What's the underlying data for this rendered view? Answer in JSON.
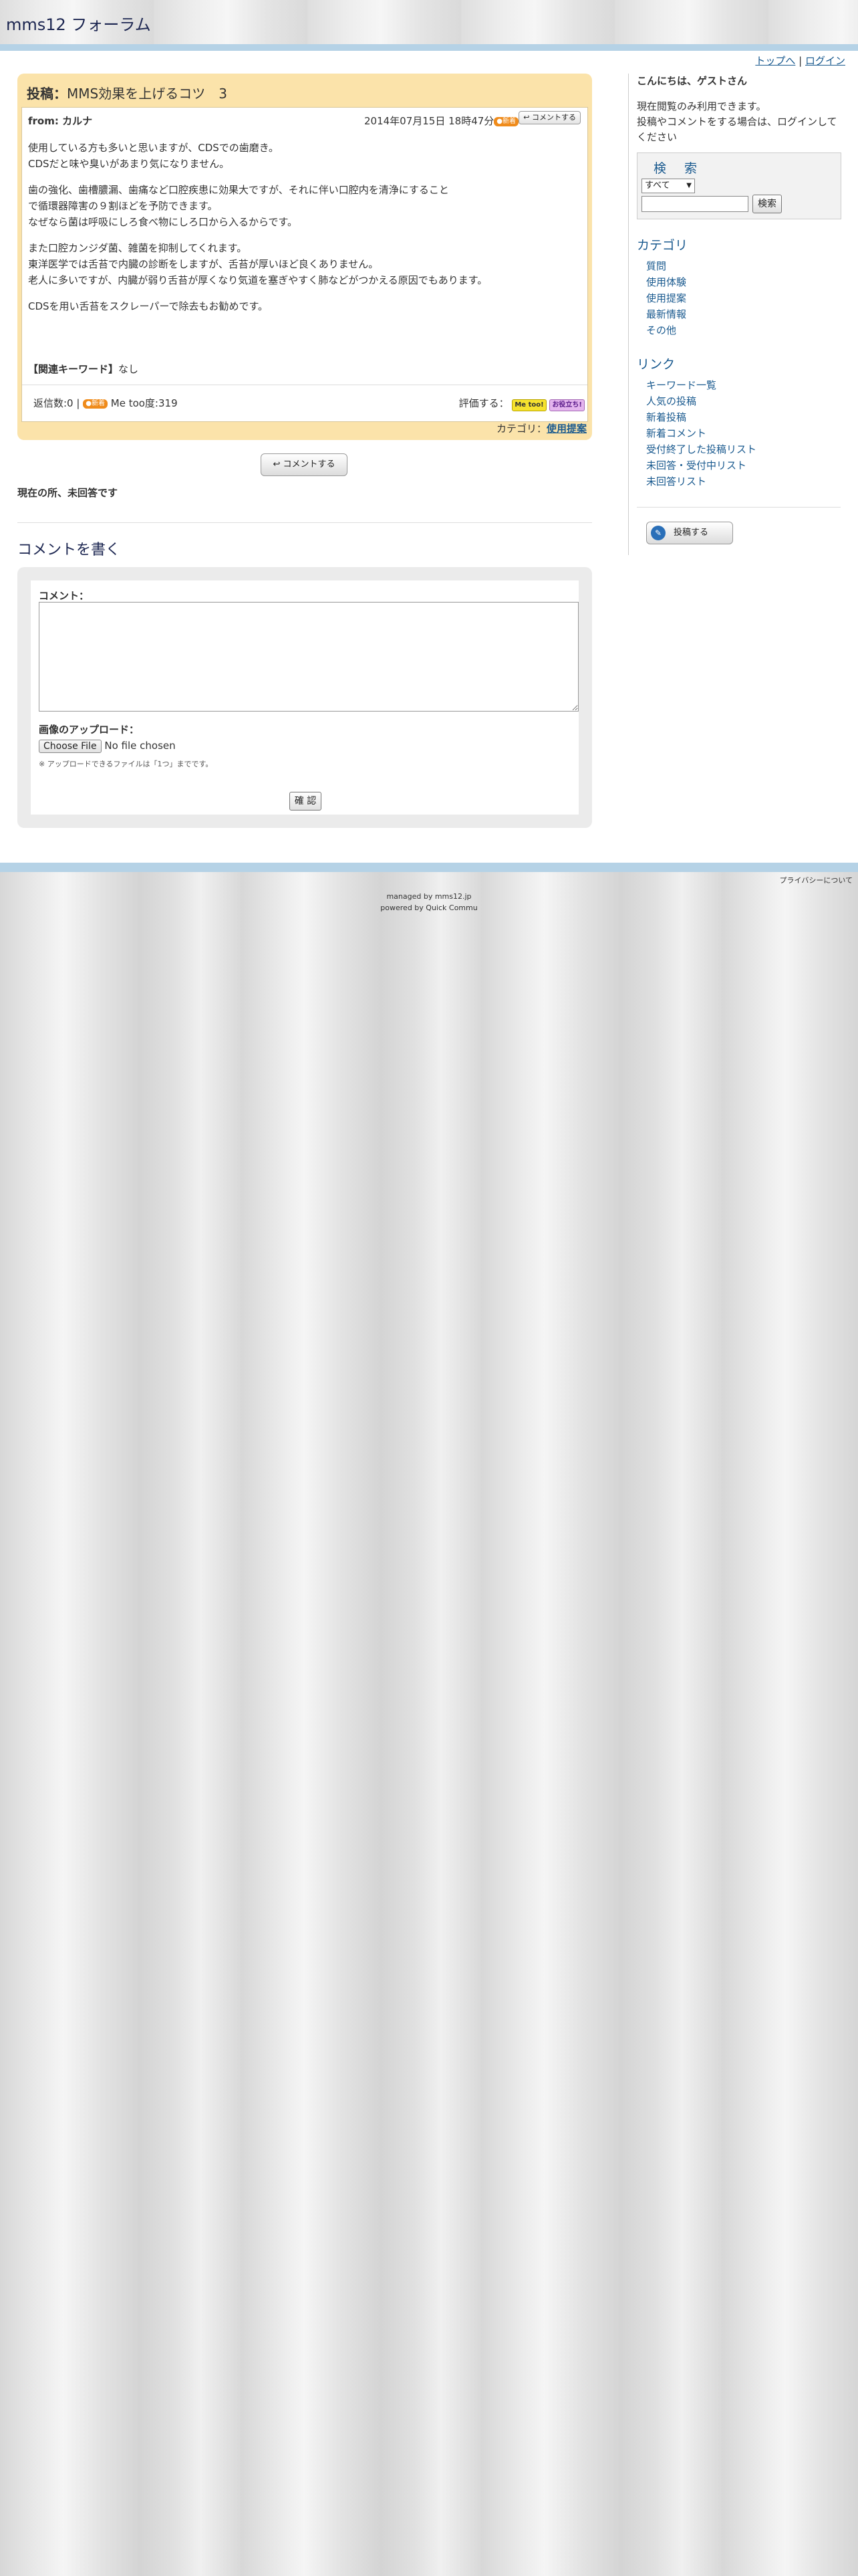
{
  "site": {
    "title": "mms12 フォーラム"
  },
  "toplinks": {
    "top": "トップへ",
    "separator": "|",
    "login": "ログイン"
  },
  "post": {
    "label": "投稿：",
    "title": "MMS効果を上げるコツ　3",
    "from": "from: カルナ",
    "date": "2014年07月15日 18時47分",
    "new_badge": "●新着",
    "comment_small": "コメントする",
    "body": [
      "使用している方も多いと思いますが、CDSでの歯磨き。\nCDSだと味や臭いがあまり気になりません。",
      "歯の強化、歯槽膿漏、歯痛など口腔疾患に効果大ですが、それに伴い口腔内を清浄にすること\nで循環器障害の９割ほどを予防できます。\nなぜなら菌は呼吸にしろ食べ物にしろ口から入るからです。",
      "また口腔カンジダ菌、雑菌を抑制してくれます。\n東洋医学では舌苔で内臓の診断をしますが、舌苔が厚いほど良くありません。\n老人に多いですが、内臓が弱り舌苔が厚くなり気道を塞ぎやすく肺などがつかえる原因でもあります。",
      "CDSを用い舌苔をスクレーパーで除去もお勧めです。"
    ],
    "keywords_label": "【関連キーワード】",
    "keywords_value": "なし",
    "reply_count": "返信数:0",
    "stats_sep": "|",
    "reply_badge": "●新着",
    "me_too": "Me too度:319",
    "rate_label": "評価する：",
    "me_too_btn": "Me too!",
    "otasuke_btn": "お役立ち!",
    "category_label": "カテゴリ：",
    "category_value": "使用提案"
  },
  "comment_button": "コメントする",
  "status_text": "現在の所、未回答です",
  "comment_form": {
    "heading": "コメントを書く",
    "comment_label": "コメント：",
    "comment_value": "",
    "upload_label": "画像のアップロード：",
    "file_button": "Choose File",
    "file_status": "No file chosen",
    "upload_note": "※ アップロードできるファイルは「1つ」までです。",
    "confirm": "確 認"
  },
  "sidebar": {
    "greeting": "こんにちは、ゲストさん",
    "login_note": "現在閲覧のみ利用できます。\n投稿やコメントをする場合は、ログインしてください",
    "search": {
      "title": "検　索",
      "select_value": "すべて",
      "input_value": "",
      "button": "検索"
    },
    "category_heading": "カテゴリ",
    "categories": [
      "質問",
      "使用体験",
      "使用提案",
      "最新情報",
      "その他"
    ],
    "links_heading": "リンク",
    "links": [
      "キーワード一覧",
      "人気の投稿",
      "新着投稿",
      "新着コメント",
      "受付終了した投稿リスト",
      "未回答・受付中リスト",
      "未回答リスト"
    ],
    "post_button": "投稿する"
  },
  "footer": {
    "privacy": "プライバシーについて",
    "managed": "managed by mms12.jp",
    "powered": "powered by Quick Commu"
  }
}
